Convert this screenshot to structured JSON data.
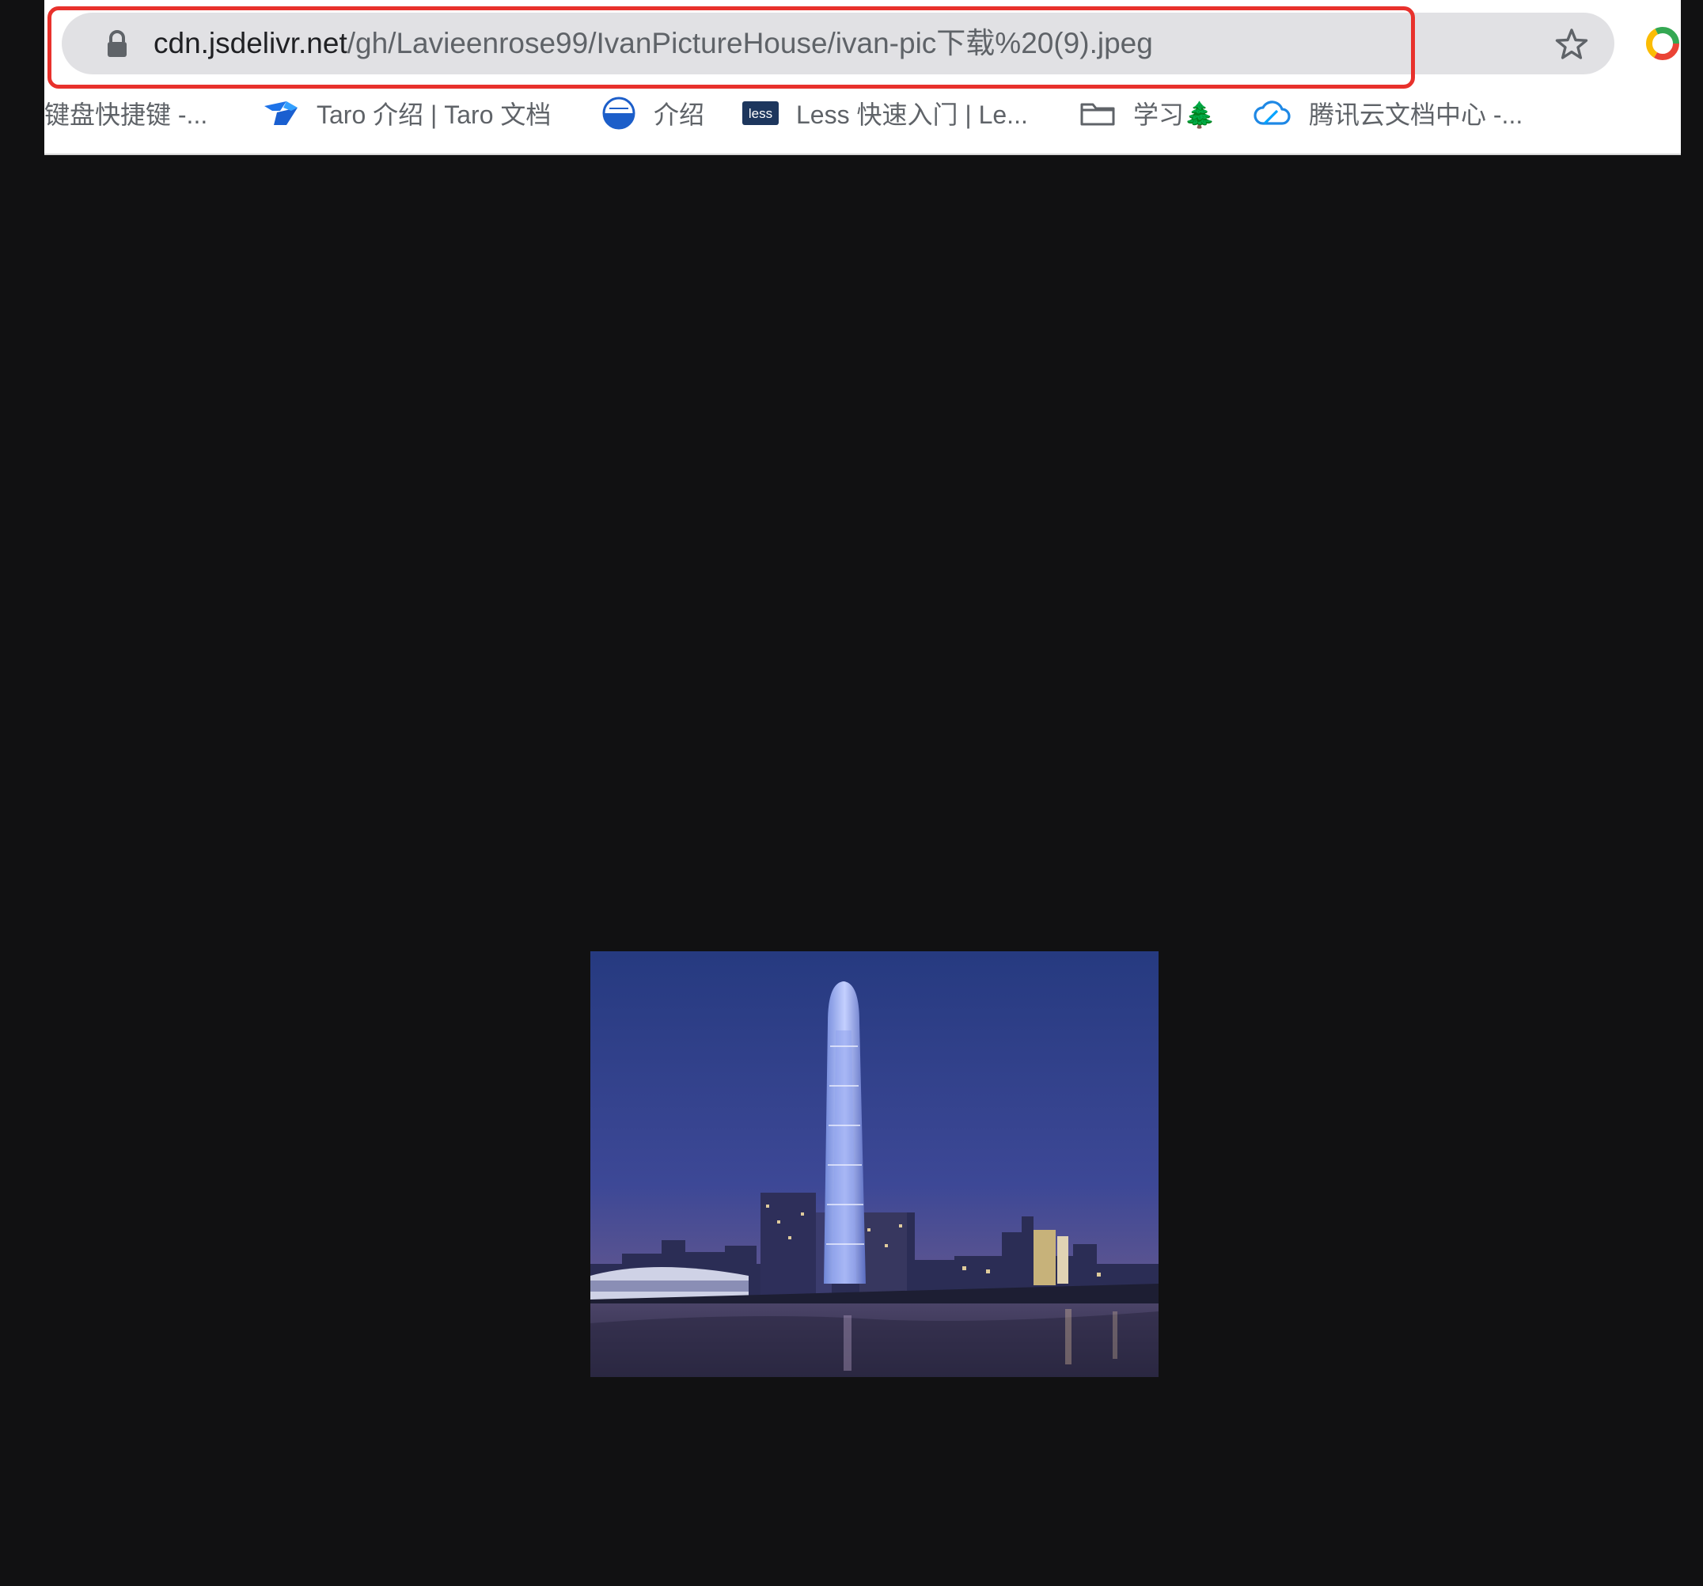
{
  "address_bar": {
    "url_host": "cdn.jsdelivr.net",
    "url_path": "/gh/Lavieenrose99/IvanPictureHouse/ivan-pic下载%20(9).jpeg"
  },
  "bookmarks": [
    {
      "label": "键盘快捷键 -...",
      "icon": "none"
    },
    {
      "label": "Taro 介绍 | Taro 文档",
      "icon": "taro-icon"
    },
    {
      "label": "介绍",
      "icon": "blue-globe-icon"
    },
    {
      "label": "Less 快速入门 | Le...",
      "icon": "less-icon",
      "icon_text": "less"
    },
    {
      "label": "学习🌲",
      "icon": "folder-icon"
    },
    {
      "label": "腾讯云文档中心 -...",
      "icon": "tencent-cloud-icon"
    }
  ],
  "content": {
    "image_subject": "city skyline at dusk with tall tower by river"
  },
  "colors": {
    "highlight": "#e8312c",
    "page_bg": "#111112"
  }
}
